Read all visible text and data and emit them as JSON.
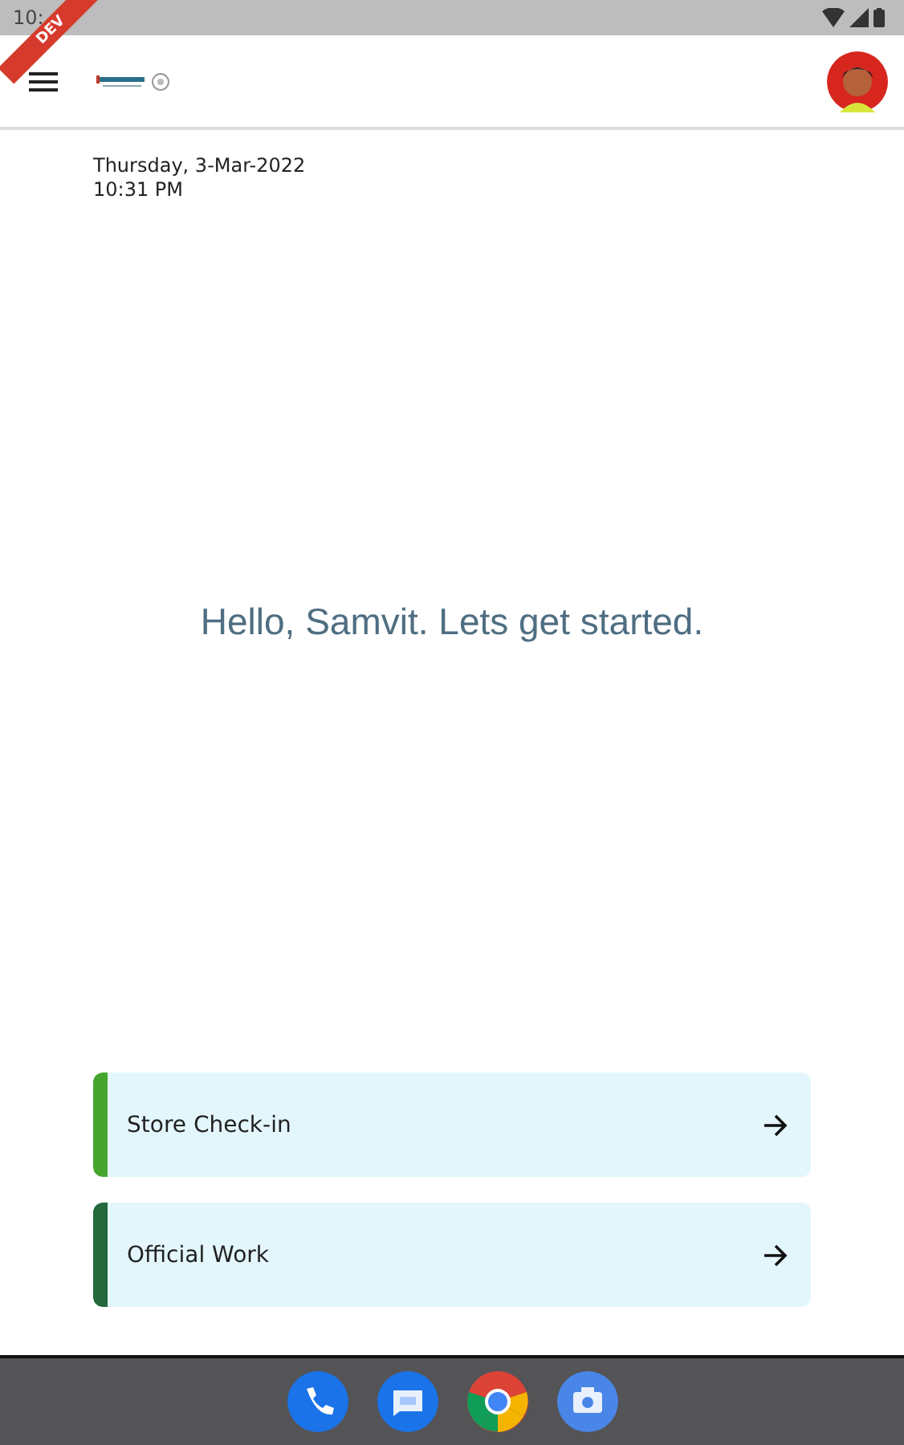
{
  "status_bar": {
    "time": "10:",
    "banner": "DEV"
  },
  "date": "Thursday, 3-Mar-2022",
  "time": "10:31 PM",
  "greeting": "Hello, Samvit. Lets get started.",
  "actions": [
    {
      "label": "Store Check-in",
      "color": "#45a52e"
    },
    {
      "label": "Official Work",
      "color": "#24683c"
    }
  ],
  "dock": [
    {
      "kind": "phone"
    },
    {
      "kind": "messages"
    },
    {
      "kind": "browser"
    },
    {
      "kind": "camera"
    }
  ]
}
